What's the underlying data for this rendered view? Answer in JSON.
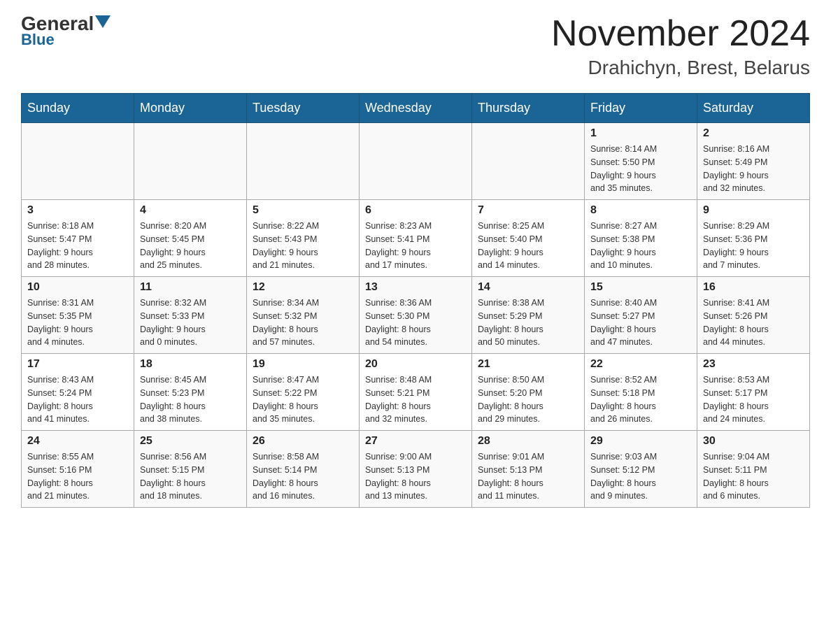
{
  "header": {
    "logo_general": "General",
    "logo_blue": "Blue",
    "title": "November 2024",
    "subtitle": "Drahichyn, Brest, Belarus"
  },
  "weekdays": [
    "Sunday",
    "Monday",
    "Tuesday",
    "Wednesday",
    "Thursday",
    "Friday",
    "Saturday"
  ],
  "rows": [
    [
      {
        "day": "",
        "info": ""
      },
      {
        "day": "",
        "info": ""
      },
      {
        "day": "",
        "info": ""
      },
      {
        "day": "",
        "info": ""
      },
      {
        "day": "",
        "info": ""
      },
      {
        "day": "1",
        "info": "Sunrise: 8:14 AM\nSunset: 5:50 PM\nDaylight: 9 hours\nand 35 minutes."
      },
      {
        "day": "2",
        "info": "Sunrise: 8:16 AM\nSunset: 5:49 PM\nDaylight: 9 hours\nand 32 minutes."
      }
    ],
    [
      {
        "day": "3",
        "info": "Sunrise: 8:18 AM\nSunset: 5:47 PM\nDaylight: 9 hours\nand 28 minutes."
      },
      {
        "day": "4",
        "info": "Sunrise: 8:20 AM\nSunset: 5:45 PM\nDaylight: 9 hours\nand 25 minutes."
      },
      {
        "day": "5",
        "info": "Sunrise: 8:22 AM\nSunset: 5:43 PM\nDaylight: 9 hours\nand 21 minutes."
      },
      {
        "day": "6",
        "info": "Sunrise: 8:23 AM\nSunset: 5:41 PM\nDaylight: 9 hours\nand 17 minutes."
      },
      {
        "day": "7",
        "info": "Sunrise: 8:25 AM\nSunset: 5:40 PM\nDaylight: 9 hours\nand 14 minutes."
      },
      {
        "day": "8",
        "info": "Sunrise: 8:27 AM\nSunset: 5:38 PM\nDaylight: 9 hours\nand 10 minutes."
      },
      {
        "day": "9",
        "info": "Sunrise: 8:29 AM\nSunset: 5:36 PM\nDaylight: 9 hours\nand 7 minutes."
      }
    ],
    [
      {
        "day": "10",
        "info": "Sunrise: 8:31 AM\nSunset: 5:35 PM\nDaylight: 9 hours\nand 4 minutes."
      },
      {
        "day": "11",
        "info": "Sunrise: 8:32 AM\nSunset: 5:33 PM\nDaylight: 9 hours\nand 0 minutes."
      },
      {
        "day": "12",
        "info": "Sunrise: 8:34 AM\nSunset: 5:32 PM\nDaylight: 8 hours\nand 57 minutes."
      },
      {
        "day": "13",
        "info": "Sunrise: 8:36 AM\nSunset: 5:30 PM\nDaylight: 8 hours\nand 54 minutes."
      },
      {
        "day": "14",
        "info": "Sunrise: 8:38 AM\nSunset: 5:29 PM\nDaylight: 8 hours\nand 50 minutes."
      },
      {
        "day": "15",
        "info": "Sunrise: 8:40 AM\nSunset: 5:27 PM\nDaylight: 8 hours\nand 47 minutes."
      },
      {
        "day": "16",
        "info": "Sunrise: 8:41 AM\nSunset: 5:26 PM\nDaylight: 8 hours\nand 44 minutes."
      }
    ],
    [
      {
        "day": "17",
        "info": "Sunrise: 8:43 AM\nSunset: 5:24 PM\nDaylight: 8 hours\nand 41 minutes."
      },
      {
        "day": "18",
        "info": "Sunrise: 8:45 AM\nSunset: 5:23 PM\nDaylight: 8 hours\nand 38 minutes."
      },
      {
        "day": "19",
        "info": "Sunrise: 8:47 AM\nSunset: 5:22 PM\nDaylight: 8 hours\nand 35 minutes."
      },
      {
        "day": "20",
        "info": "Sunrise: 8:48 AM\nSunset: 5:21 PM\nDaylight: 8 hours\nand 32 minutes."
      },
      {
        "day": "21",
        "info": "Sunrise: 8:50 AM\nSunset: 5:20 PM\nDaylight: 8 hours\nand 29 minutes."
      },
      {
        "day": "22",
        "info": "Sunrise: 8:52 AM\nSunset: 5:18 PM\nDaylight: 8 hours\nand 26 minutes."
      },
      {
        "day": "23",
        "info": "Sunrise: 8:53 AM\nSunset: 5:17 PM\nDaylight: 8 hours\nand 24 minutes."
      }
    ],
    [
      {
        "day": "24",
        "info": "Sunrise: 8:55 AM\nSunset: 5:16 PM\nDaylight: 8 hours\nand 21 minutes."
      },
      {
        "day": "25",
        "info": "Sunrise: 8:56 AM\nSunset: 5:15 PM\nDaylight: 8 hours\nand 18 minutes."
      },
      {
        "day": "26",
        "info": "Sunrise: 8:58 AM\nSunset: 5:14 PM\nDaylight: 8 hours\nand 16 minutes."
      },
      {
        "day": "27",
        "info": "Sunrise: 9:00 AM\nSunset: 5:13 PM\nDaylight: 8 hours\nand 13 minutes."
      },
      {
        "day": "28",
        "info": "Sunrise: 9:01 AM\nSunset: 5:13 PM\nDaylight: 8 hours\nand 11 minutes."
      },
      {
        "day": "29",
        "info": "Sunrise: 9:03 AM\nSunset: 5:12 PM\nDaylight: 8 hours\nand 9 minutes."
      },
      {
        "day": "30",
        "info": "Sunrise: 9:04 AM\nSunset: 5:11 PM\nDaylight: 8 hours\nand 6 minutes."
      }
    ]
  ]
}
